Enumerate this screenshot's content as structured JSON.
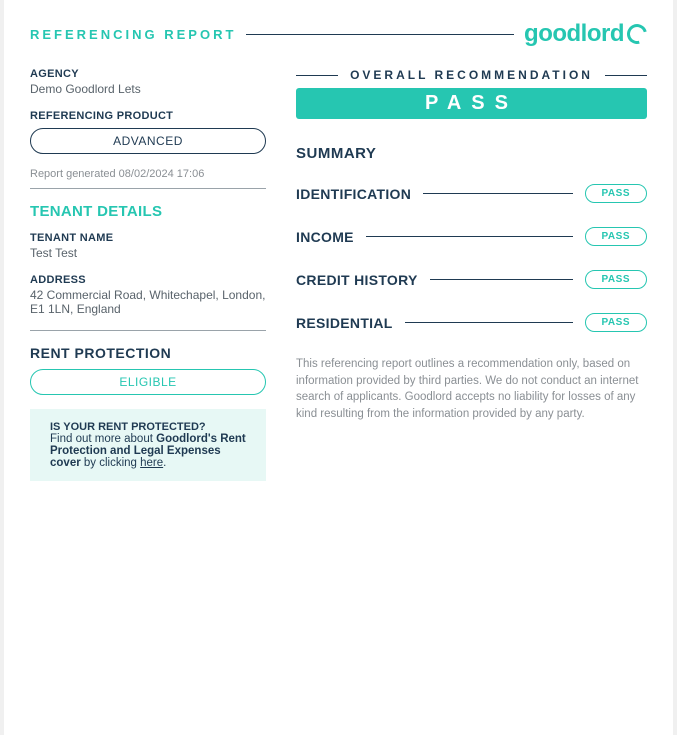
{
  "brand": "goodlord",
  "header_title": "REFERENCING REPORT",
  "left": {
    "agency": {
      "label": "AGENCY",
      "value": "Demo Goodlord Lets"
    },
    "product": {
      "label": "REFERENCING PRODUCT",
      "value": "ADVANCED"
    },
    "generated": "Report generated 08/02/2024 17:06",
    "tenant_section": "TENANT DETAILS",
    "tenant_name": {
      "label": "TENANT NAME",
      "value": "Test Test"
    },
    "address": {
      "label": "ADDRESS",
      "value": "42 Commercial Road, Whitechapel, London, E1 1LN, England"
    },
    "rent_section": "RENT PROTECTION",
    "rent_status": "ELIGIBLE",
    "promo": {
      "question": "IS YOUR RENT PROTECTED?",
      "lead": "Find out more about ",
      "bold": "Goodlord's Rent Protection and Legal Expenses cover",
      "tail": " by clicking ",
      "link": "here"
    }
  },
  "right": {
    "rec_title": "OVERALL RECOMMENDATION",
    "rec_value": "PASS",
    "summary": "SUMMARY",
    "checks": [
      {
        "name": "IDENTIFICATION",
        "status": "PASS"
      },
      {
        "name": "INCOME",
        "status": "PASS"
      },
      {
        "name": "CREDIT HISTORY",
        "status": "PASS"
      },
      {
        "name": "RESIDENTIAL",
        "status": "PASS"
      }
    ],
    "disclaimer": "This referencing report outlines a recommendation only, based on information provided by third parties. We do not conduct an internet search of applicants. Goodlord accepts no liability for losses of any kind resulting from the information provided by any party."
  }
}
